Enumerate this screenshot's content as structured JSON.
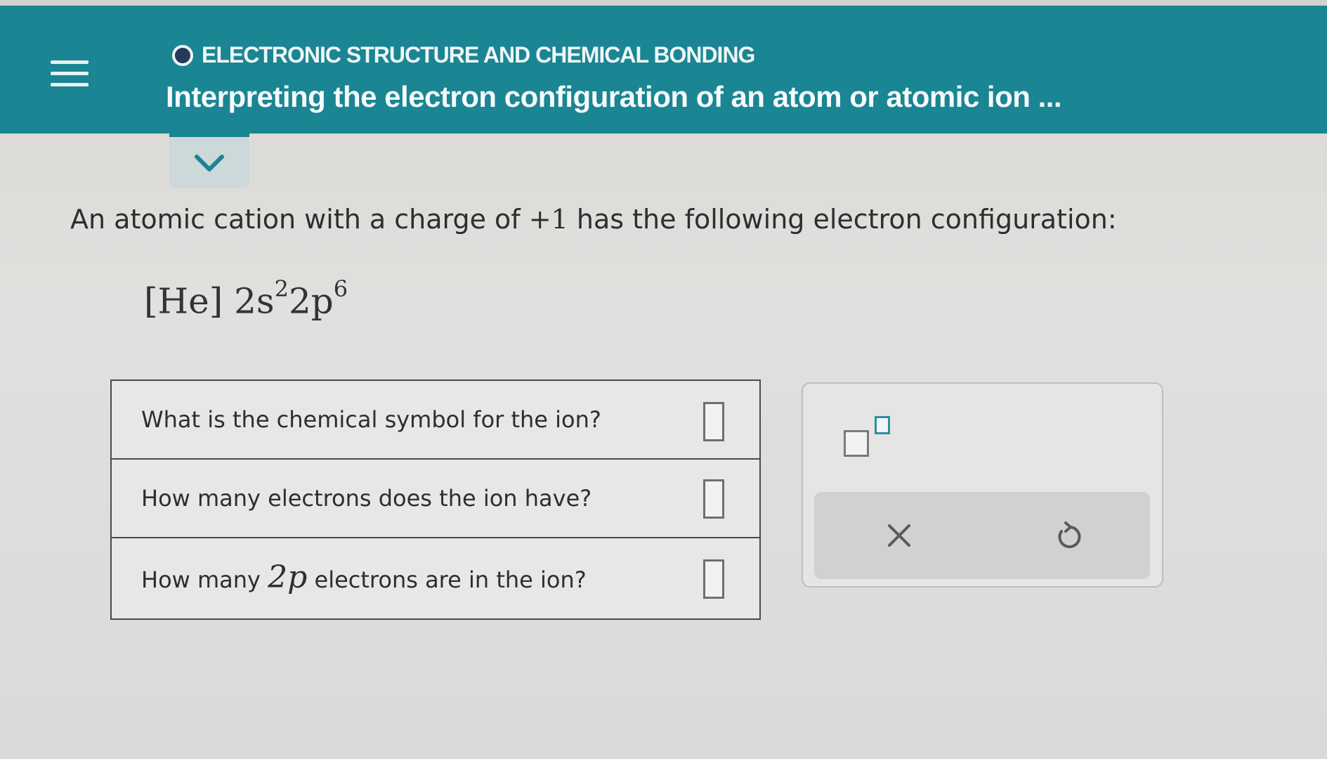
{
  "header": {
    "topic": "ELECTRONIC STRUCTURE AND CHEMICAL BONDING",
    "title": "Interpreting the electron configuration of an atom or atomic ion ..."
  },
  "problem": {
    "prompt_before": "An atomic cation with a charge of ",
    "charge": "+1",
    "prompt_after": " has the following electron configuration:",
    "configuration": {
      "core": "[He]",
      "orbital_1": "2s",
      "exp_1": "2",
      "orbital_2": "2p",
      "exp_2": "6"
    }
  },
  "questions": [
    {
      "label": "What is the chemical symbol for the ion?",
      "value": ""
    },
    {
      "label": "How many electrons does the ion have?",
      "value": ""
    },
    {
      "label_before": "How many ",
      "math": "2p",
      "label_after": " electrons are in the ion?",
      "value": ""
    }
  ],
  "toolbar": {
    "superscript_icon": "superscript-box-icon",
    "clear_icon": "x-icon",
    "reset_icon": "undo-icon"
  },
  "colors": {
    "header_bg": "#1a8593",
    "accent": "#2d8fa0"
  }
}
